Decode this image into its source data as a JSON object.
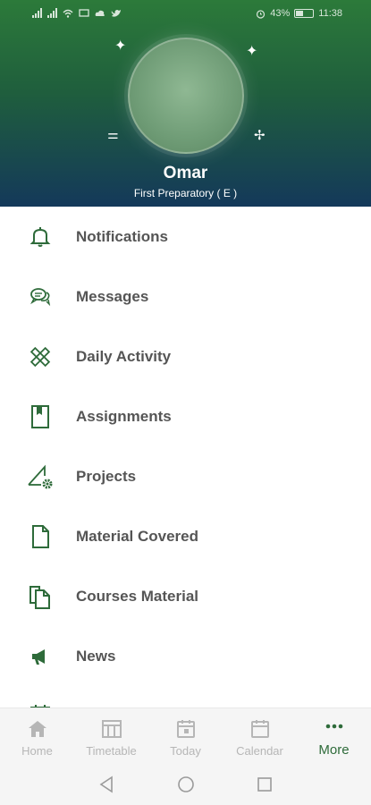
{
  "status_bar": {
    "battery_percent": "43%",
    "time": "11:38"
  },
  "profile": {
    "name": "Omar",
    "class_label": "First Preparatory ( E )"
  },
  "menu": {
    "items": [
      {
        "label": "Notifications",
        "icon": "bell-icon"
      },
      {
        "label": "Messages",
        "icon": "chat-bubbles-icon"
      },
      {
        "label": "Daily Activity",
        "icon": "pencil-ruler-icon"
      },
      {
        "label": "Assignments",
        "icon": "book-bookmark-icon"
      },
      {
        "label": "Projects",
        "icon": "triangle-gear-icon"
      },
      {
        "label": "Material Covered",
        "icon": "document-icon"
      },
      {
        "label": "Courses Material",
        "icon": "documents-copy-icon"
      },
      {
        "label": "News",
        "icon": "megaphone-icon"
      },
      {
        "label": "",
        "icon": "calendar-partial-icon"
      }
    ]
  },
  "tabs": [
    {
      "label": "Home",
      "icon": "home-icon",
      "active": false
    },
    {
      "label": "Timetable",
      "icon": "timetable-icon",
      "active": false
    },
    {
      "label": "Today",
      "icon": "today-calendar-icon",
      "active": false
    },
    {
      "label": "Calendar",
      "icon": "calendar-icon",
      "active": false
    },
    {
      "label": "More",
      "icon": "more-dots-icon",
      "active": true
    }
  ],
  "colors": {
    "accent_green": "#2e6b3a",
    "header_top": "#2c7a3a",
    "header_bottom": "#14395a",
    "menu_text": "#555555",
    "tab_inactive": "#b6b6b6"
  }
}
